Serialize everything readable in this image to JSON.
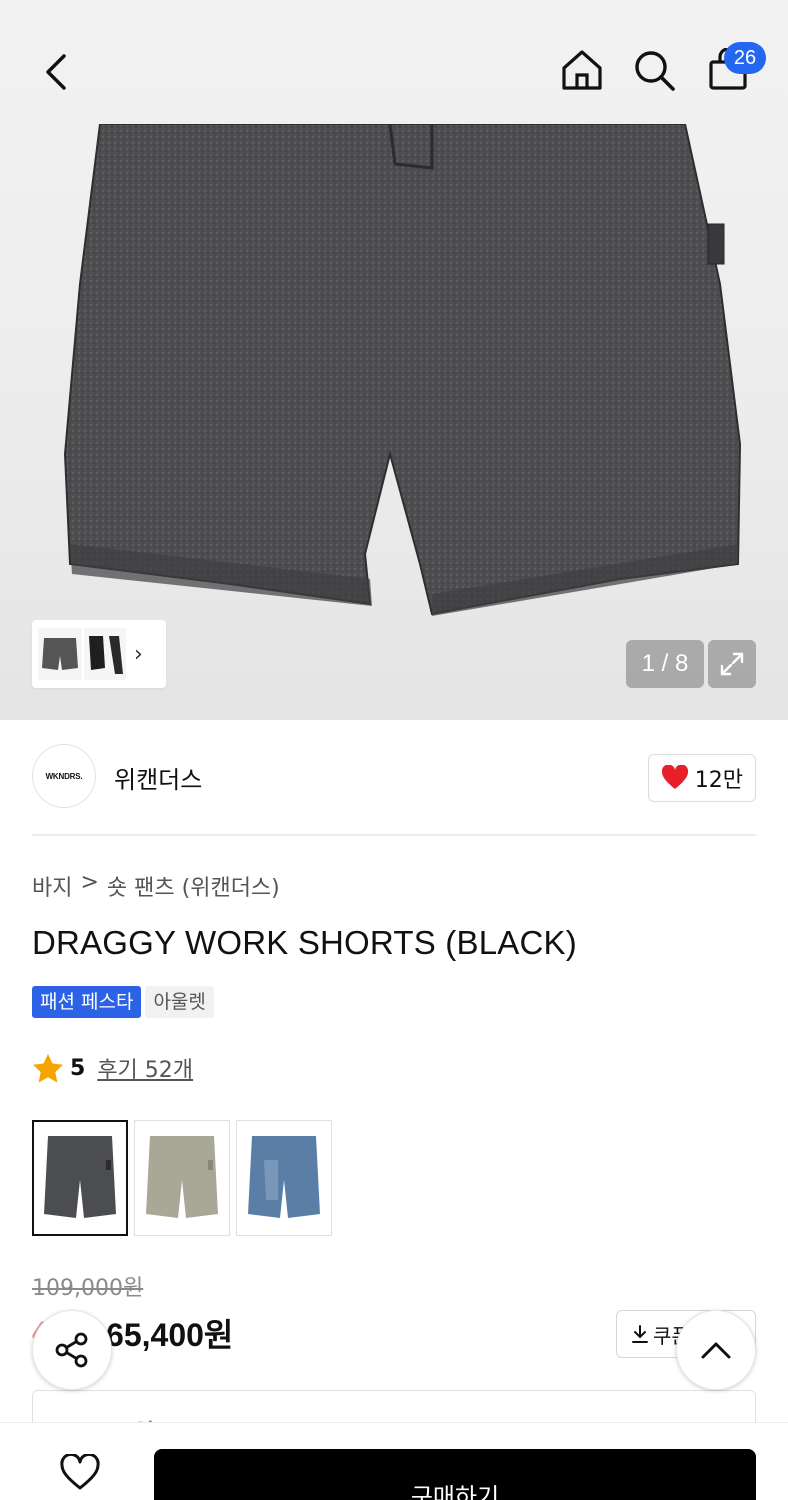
{
  "header": {
    "cart_count": "26",
    "icons": [
      "chevron-left-icon",
      "home-icon",
      "search-icon",
      "shopping-bag-icon"
    ]
  },
  "gallery": {
    "counter": "1 / 8",
    "thumb_arrow": "›",
    "image_colors": {
      "denim": "#4a4a4a",
      "seam": "#2f2f2f"
    }
  },
  "brand": {
    "logo_text": "WKNDRS.",
    "name": "위캔더스",
    "likes": "12만"
  },
  "product": {
    "breadcrumb": [
      "바지",
      "숏 팬츠 (위캔더스)"
    ],
    "breadcrumb_sep": ">",
    "title": "DRAGGY WORK SHORTS (BLACK)",
    "tags": [
      "패션 페스타",
      "아울렛"
    ],
    "rating": "5",
    "reviews": "후기 52개",
    "color_options": [
      {
        "name": "black",
        "color": "#4c4d51"
      },
      {
        "name": "beige",
        "color": "#a9a897"
      },
      {
        "name": "blue",
        "color": "#5b7ea6"
      }
    ]
  },
  "price": {
    "original": "109,000원",
    "discount": "40%",
    "sale": "65,400원",
    "coupon_label": "쿠폰",
    "benefit_text": "51,700원"
  },
  "bottom": {
    "buy_label": "구매하기"
  },
  "colors": {
    "accent_blue": "#2367f0",
    "sale_red": "#f23a3a",
    "heart_red": "#e8202a"
  }
}
